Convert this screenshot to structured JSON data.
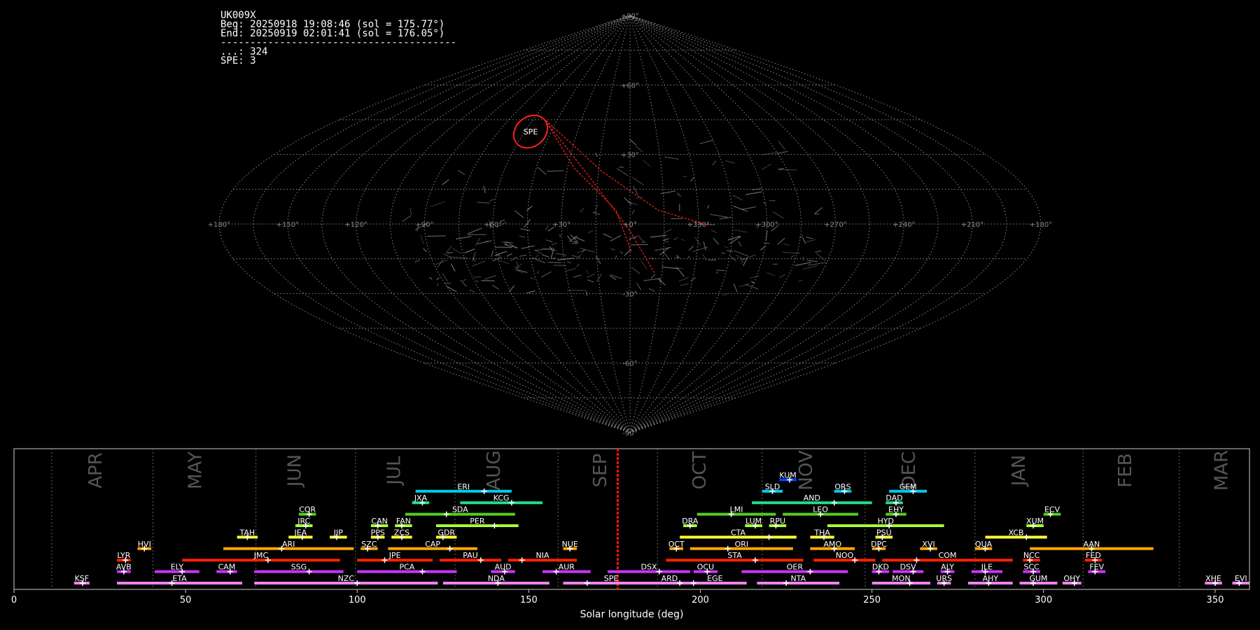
{
  "info": {
    "station": "UK009X",
    "begin": "Beg: 20250918 19:08:46 (sol = 175.77°)",
    "end": "End: 20250919 02:01:41 (sol = 176.05°)",
    "separator": "----------------------------------------",
    "count_line": "...: 324",
    "spe_line": "SPE: 3"
  },
  "chart_data": [
    {
      "type": "scatter",
      "title": "",
      "projection": "sinusoidal",
      "lon_ticks": [
        "+180°",
        "+150°",
        "+120°",
        "+90°",
        "+60°",
        "+30°",
        "+0°",
        "+330°",
        "+300°",
        "+270°",
        "+240°",
        "+210°",
        "+180°"
      ],
      "lat_ticks": [
        "+90°",
        "+60°",
        "+30°",
        "+0°",
        "-30°",
        "-60°",
        "-90°"
      ],
      "highlight": {
        "label": "SPE",
        "color": "#ff2020"
      },
      "colors": {
        "grid": "#8a8a8a",
        "tracks": "#9a9a9a",
        "highlight": "#ff2020"
      }
    },
    {
      "type": "timeline",
      "xlabel": "Solar longitude (deg)",
      "xlim": [
        0,
        360
      ],
      "xticks": [
        0,
        50,
        100,
        150,
        200,
        250,
        300,
        350
      ],
      "current_sol": 175.9,
      "months": [
        {
          "name": "APR",
          "start": 11,
          "label_at": 24
        },
        {
          "name": "MAY",
          "start": 40.5,
          "label_at": 53
        },
        {
          "name": "JUN",
          "start": 70.5,
          "label_at": 82
        },
        {
          "name": "JUL",
          "start": 99.5,
          "label_at": 111
        },
        {
          "name": "AUG",
          "start": 128.5,
          "label_at": 140
        },
        {
          "name": "SEP",
          "start": 158.5,
          "label_at": 171
        },
        {
          "name": "OCT",
          "start": 187.5,
          "label_at": 200
        },
        {
          "name": "NOV",
          "start": 218,
          "label_at": 231
        },
        {
          "name": "DEC",
          "start": 248,
          "label_at": 261
        },
        {
          "name": "JAN",
          "start": 280,
          "label_at": 293
        },
        {
          "name": "FEB",
          "start": 311.5,
          "label_at": 324
        },
        {
          "name": "MAR",
          "start": 339.5,
          "label_at": 352
        }
      ],
      "showers": [
        {
          "code": "KSF",
          "row": 0,
          "start": 17.5,
          "end": 22,
          "peak": 20,
          "color": "#ee82ee"
        },
        {
          "code": "ETA",
          "row": 0,
          "start": 30,
          "end": 66.5,
          "peak": 46,
          "color": "#ee82ee"
        },
        {
          "code": "NZC",
          "row": 0,
          "start": 70,
          "end": 123.5,
          "peak": 100,
          "color": "#ee82ee"
        },
        {
          "code": "NDA",
          "row": 0,
          "start": 125,
          "end": 156,
          "peak": 141,
          "color": "#ee82ee"
        },
        {
          "code": "SPE",
          "row": 0,
          "start": 160,
          "end": 188,
          "peak": 167,
          "color": "#ee82ee"
        },
        {
          "code": "ARD",
          "row": 0,
          "start": 184,
          "end": 198,
          "peak": 194,
          "color": "#ee82ee"
        },
        {
          "code": "EGE",
          "row": 0,
          "start": 195,
          "end": 213.5,
          "peak": 198,
          "color": "#ee82ee"
        },
        {
          "code": "NTA",
          "row": 0,
          "start": 216.5,
          "end": 240.5,
          "peak": 225,
          "color": "#ee82ee"
        },
        {
          "code": "MON",
          "row": 0,
          "start": 250,
          "end": 267,
          "peak": 261,
          "color": "#ee82ee"
        },
        {
          "code": "URS",
          "row": 0,
          "start": 269,
          "end": 273,
          "peak": 271,
          "color": "#ee82ee"
        },
        {
          "code": "AHY",
          "row": 0,
          "start": 278,
          "end": 291,
          "peak": 284,
          "color": "#ee82ee"
        },
        {
          "code": "GUM",
          "row": 0,
          "start": 293,
          "end": 304,
          "peak": 297,
          "color": "#ee82ee"
        },
        {
          "code": "OHY",
          "row": 0,
          "start": 305.5,
          "end": 311,
          "peak": 309,
          "color": "#ee82ee"
        },
        {
          "code": "XHE",
          "row": 0,
          "start": 347,
          "end": 352,
          "peak": 350,
          "color": "#ee82ee"
        },
        {
          "code": "EVI",
          "row": 0,
          "start": 355,
          "end": 360,
          "peak": 357,
          "color": "#ee82ee"
        },
        {
          "code": "AVB",
          "row": 1,
          "start": 30,
          "end": 34,
          "peak": 32,
          "color": "#cc33ff"
        },
        {
          "code": "ELY",
          "row": 1,
          "start": 41,
          "end": 54,
          "peak": 49,
          "color": "#cc33ff"
        },
        {
          "code": "CAM",
          "row": 1,
          "start": 59,
          "end": 65,
          "peak": 63,
          "color": "#cc33ff"
        },
        {
          "code": "SSG",
          "row": 1,
          "start": 70,
          "end": 96,
          "peak": 86,
          "color": "#cc33ff"
        },
        {
          "code": "PCA",
          "row": 1,
          "start": 100,
          "end": 129,
          "peak": 119,
          "color": "#cc33ff"
        },
        {
          "code": "AUD",
          "row": 1,
          "start": 139,
          "end": 146,
          "peak": 143,
          "color": "#cc33ff"
        },
        {
          "code": "AUR",
          "row": 1,
          "start": 154,
          "end": 168,
          "peak": 158,
          "color": "#cc33ff"
        },
        {
          "code": "DSX",
          "row": 1,
          "start": 173,
          "end": 197,
          "peak": 188,
          "color": "#cc33ff"
        },
        {
          "code": "OCU",
          "row": 1,
          "start": 198,
          "end": 205,
          "peak": 202,
          "color": "#cc33ff"
        },
        {
          "code": "OER",
          "row": 1,
          "start": 212,
          "end": 243,
          "peak": 232,
          "color": "#cc33ff"
        },
        {
          "code": "DKD",
          "row": 1,
          "start": 250,
          "end": 255,
          "peak": 252,
          "color": "#cc33ff"
        },
        {
          "code": "DSV",
          "row": 1,
          "start": 256,
          "end": 265,
          "peak": 262,
          "color": "#cc33ff"
        },
        {
          "code": "ALY",
          "row": 1,
          "start": 270,
          "end": 274,
          "peak": 272,
          "color": "#cc33ff"
        },
        {
          "code": "JLE",
          "row": 1,
          "start": 279,
          "end": 288,
          "peak": 283,
          "color": "#cc33ff"
        },
        {
          "code": "SCC",
          "row": 1,
          "start": 294,
          "end": 299,
          "peak": 297,
          "color": "#cc33ff"
        },
        {
          "code": "FEV",
          "row": 1,
          "start": 313,
          "end": 318,
          "peak": 315,
          "color": "#cc33ff"
        },
        {
          "code": "LYR",
          "row": 2,
          "start": 30,
          "end": 34,
          "peak": 32.5,
          "color": "#ff2200"
        },
        {
          "code": "JMC",
          "row": 2,
          "start": 49,
          "end": 95,
          "peak": 74,
          "color": "#ff2200"
        },
        {
          "code": "JPE",
          "row": 2,
          "start": 100,
          "end": 122,
          "peak": 108,
          "color": "#ff2200"
        },
        {
          "code": "PAU",
          "row": 2,
          "start": 124,
          "end": 142,
          "peak": 136,
          "color": "#ff2200"
        },
        {
          "code": "NIA",
          "row": 2,
          "start": 144,
          "end": 164,
          "peak": 148,
          "color": "#ff2200"
        },
        {
          "code": "STA",
          "row": 2,
          "start": 190,
          "end": 230,
          "peak": 216,
          "color": "#ff2200"
        },
        {
          "code": "NOO",
          "row": 2,
          "start": 233,
          "end": 251,
          "peak": 245,
          "color": "#ff2200"
        },
        {
          "code": "COM",
          "row": 2,
          "start": 253,
          "end": 291,
          "peak": 263,
          "color": "#ff2200"
        },
        {
          "code": "NCC",
          "row": 2,
          "start": 294,
          "end": 299,
          "peak": 296,
          "color": "#ff2200"
        },
        {
          "code": "FED",
          "row": 2,
          "start": 312,
          "end": 317,
          "peak": 315,
          "color": "#ff2200"
        },
        {
          "code": "HVI",
          "row": 3,
          "start": 36,
          "end": 40,
          "peak": 38,
          "color": "#ffa500"
        },
        {
          "code": "ARI",
          "row": 3,
          "start": 61,
          "end": 99,
          "peak": 78,
          "color": "#ffa500"
        },
        {
          "code": "SZC",
          "row": 3,
          "start": 101,
          "end": 106,
          "peak": 103,
          "color": "#ffa500"
        },
        {
          "code": "CAP",
          "row": 3,
          "start": 109,
          "end": 135,
          "peak": 127,
          "color": "#ffa500"
        },
        {
          "code": "NUE",
          "row": 3,
          "start": 160,
          "end": 164,
          "peak": 162,
          "color": "#ffa500"
        },
        {
          "code": "OCT",
          "row": 3,
          "start": 191,
          "end": 195,
          "peak": 193,
          "color": "#ffa500"
        },
        {
          "code": "ORI",
          "row": 3,
          "start": 197,
          "end": 227,
          "peak": 208,
          "color": "#ffa500"
        },
        {
          "code": "AMO",
          "row": 3,
          "start": 232,
          "end": 245,
          "peak": 239,
          "color": "#ffa500"
        },
        {
          "code": "DPC",
          "row": 3,
          "start": 250,
          "end": 254,
          "peak": 252,
          "color": "#ffa500"
        },
        {
          "code": "XVI",
          "row": 3,
          "start": 264,
          "end": 269,
          "peak": 267,
          "color": "#ffa500"
        },
        {
          "code": "QUA",
          "row": 3,
          "start": 280,
          "end": 285,
          "peak": 283,
          "color": "#ffa500"
        },
        {
          "code": "AAN",
          "row": 3,
          "start": 296,
          "end": 332,
          "peak": 314,
          "color": "#ffa500"
        },
        {
          "code": "TAH",
          "row": 4,
          "start": 65,
          "end": 71,
          "peak": 68,
          "color": "#ffff33"
        },
        {
          "code": "JEA",
          "row": 4,
          "start": 80,
          "end": 87,
          "peak": 84,
          "color": "#ffff33"
        },
        {
          "code": "JIP",
          "row": 4,
          "start": 92,
          "end": 97,
          "peak": 94,
          "color": "#ffff33"
        },
        {
          "code": "PPS",
          "row": 4,
          "start": 104,
          "end": 108,
          "peak": 106,
          "color": "#ffff33"
        },
        {
          "code": "ZCS",
          "row": 4,
          "start": 110,
          "end": 116,
          "peak": 113,
          "color": "#ffff33"
        },
        {
          "code": "GDR",
          "row": 4,
          "start": 123,
          "end": 129,
          "peak": 125,
          "color": "#ffff33"
        },
        {
          "code": "CTA",
          "row": 4,
          "start": 194,
          "end": 228,
          "peak": 220,
          "color": "#ffff33"
        },
        {
          "code": "THA",
          "row": 4,
          "start": 232,
          "end": 239,
          "peak": 236,
          "color": "#ffff33"
        },
        {
          "code": "PSU",
          "row": 4,
          "start": 251,
          "end": 256,
          "peak": 253,
          "color": "#ffff33"
        },
        {
          "code": "XCB",
          "row": 4,
          "start": 283,
          "end": 301,
          "peak": 295,
          "color": "#ffff33"
        },
        {
          "code": "JRC",
          "row": 5,
          "start": 82,
          "end": 87,
          "peak": 85,
          "color": "#aaff33"
        },
        {
          "code": "CAN",
          "row": 5,
          "start": 104,
          "end": 109,
          "peak": 106,
          "color": "#aaff33"
        },
        {
          "code": "FAN",
          "row": 5,
          "start": 111,
          "end": 116,
          "peak": 113,
          "color": "#aaff33"
        },
        {
          "code": "PER",
          "row": 5,
          "start": 123,
          "end": 147,
          "peak": 140,
          "color": "#aaff33"
        },
        {
          "code": "DRA",
          "row": 5,
          "start": 195,
          "end": 199,
          "peak": 197,
          "color": "#aaff33"
        },
        {
          "code": "LUM",
          "row": 5,
          "start": 213,
          "end": 218,
          "peak": 216,
          "color": "#aaff33"
        },
        {
          "code": "RPU",
          "row": 5,
          "start": 220,
          "end": 225,
          "peak": 222,
          "color": "#aaff33"
        },
        {
          "code": "HYD",
          "row": 5,
          "start": 237,
          "end": 271,
          "peak": 255,
          "color": "#aaff33"
        },
        {
          "code": "XUM",
          "row": 5,
          "start": 295,
          "end": 300,
          "peak": 297,
          "color": "#aaff33"
        },
        {
          "code": "COR",
          "row": 6,
          "start": 83,
          "end": 88,
          "peak": 86,
          "color": "#55cc22"
        },
        {
          "code": "SDA",
          "row": 6,
          "start": 114,
          "end": 146,
          "peak": 126,
          "color": "#55cc22"
        },
        {
          "code": "LMI",
          "row": 6,
          "start": 199,
          "end": 222,
          "peak": 209,
          "color": "#55cc22"
        },
        {
          "code": "LEO",
          "row": 6,
          "start": 224,
          "end": 246,
          "peak": 235,
          "color": "#55cc22"
        },
        {
          "code": "EHY",
          "row": 6,
          "start": 254,
          "end": 260,
          "peak": 257,
          "color": "#55cc22"
        },
        {
          "code": "ECV",
          "row": 6,
          "start": 300,
          "end": 305,
          "peak": 302,
          "color": "#55cc22"
        },
        {
          "code": "JXA",
          "row": 7,
          "start": 116,
          "end": 121,
          "peak": 119,
          "color": "#22dd88"
        },
        {
          "code": "KCG",
          "row": 7,
          "start": 130,
          "end": 154,
          "peak": 145,
          "color": "#22dd88"
        },
        {
          "code": "AND",
          "row": 7,
          "start": 215,
          "end": 250,
          "peak": 239,
          "color": "#22dd88"
        },
        {
          "code": "DAD",
          "row": 7,
          "start": 254,
          "end": 259,
          "peak": 257,
          "color": "#22dd88"
        },
        {
          "code": "ERI",
          "row": 8,
          "start": 117,
          "end": 145,
          "peak": 137,
          "color": "#00ccee"
        },
        {
          "code": "SLD",
          "row": 8,
          "start": 218,
          "end": 224,
          "peak": 221,
          "color": "#00ccee"
        },
        {
          "code": "ORS",
          "row": 8,
          "start": 239,
          "end": 244,
          "peak": 242,
          "color": "#00ccee"
        },
        {
          "code": "GEM",
          "row": 8,
          "start": 255,
          "end": 266,
          "peak": 262,
          "color": "#00ccee"
        },
        {
          "code": "KUM",
          "row": 9,
          "start": 223,
          "end": 228,
          "peak": 226,
          "color": "#0044ff"
        }
      ]
    }
  ]
}
